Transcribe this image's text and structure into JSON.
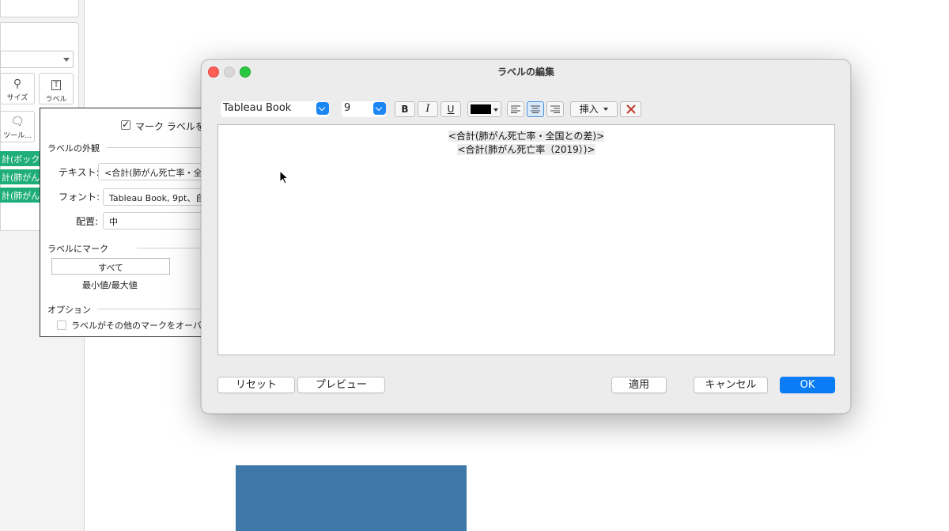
{
  "left_panel": {
    "marks": [
      {
        "label": "サイズ",
        "icon": "size-icon"
      },
      {
        "label": "ラベル",
        "icon": "label-icon"
      },
      {
        "label": "ツール...",
        "icon": "tooltip-icon"
      }
    ],
    "pills": [
      "計(ボック",
      "計(肺がん",
      "計(肺がん"
    ]
  },
  "label_popup": {
    "show_labels_text": "マーク ラベルを",
    "appearance_heading": "ラベルの外観",
    "text_label": "テキスト:",
    "text_value": "<合計(肺がん死亡率・全国",
    "font_label": "フォント:",
    "font_value": "Tableau Book, 9pt、自",
    "align_label": "配置:",
    "align_value": "中",
    "marks_heading": "ラベルにマーク",
    "all_option": "すべて",
    "minmax_option": "最小値/最大値",
    "options_heading": "オプション",
    "overlap_option": "ラベルがその他のマークをオーバ"
  },
  "dialog": {
    "title": "ラベルの編集",
    "font_family": "Tableau Book",
    "font_size": "9",
    "bold": "B",
    "italic": "I",
    "underline": "U",
    "color": "#000000",
    "insert": "挿入",
    "lines": [
      "<合計(肺がん死亡率・全国との差)>",
      "<合計(肺がん死亡率（2019）)>"
    ],
    "buttons": {
      "reset": "リセット",
      "preview": "プレビュー",
      "apply": "適用",
      "cancel": "キャンセル",
      "ok": "OK"
    }
  },
  "colors": {
    "accent": "#0a7cf6",
    "pill_green": "#1fae7a",
    "chart_blue": "#3d78a8",
    "clear_red": "#c0392b"
  }
}
